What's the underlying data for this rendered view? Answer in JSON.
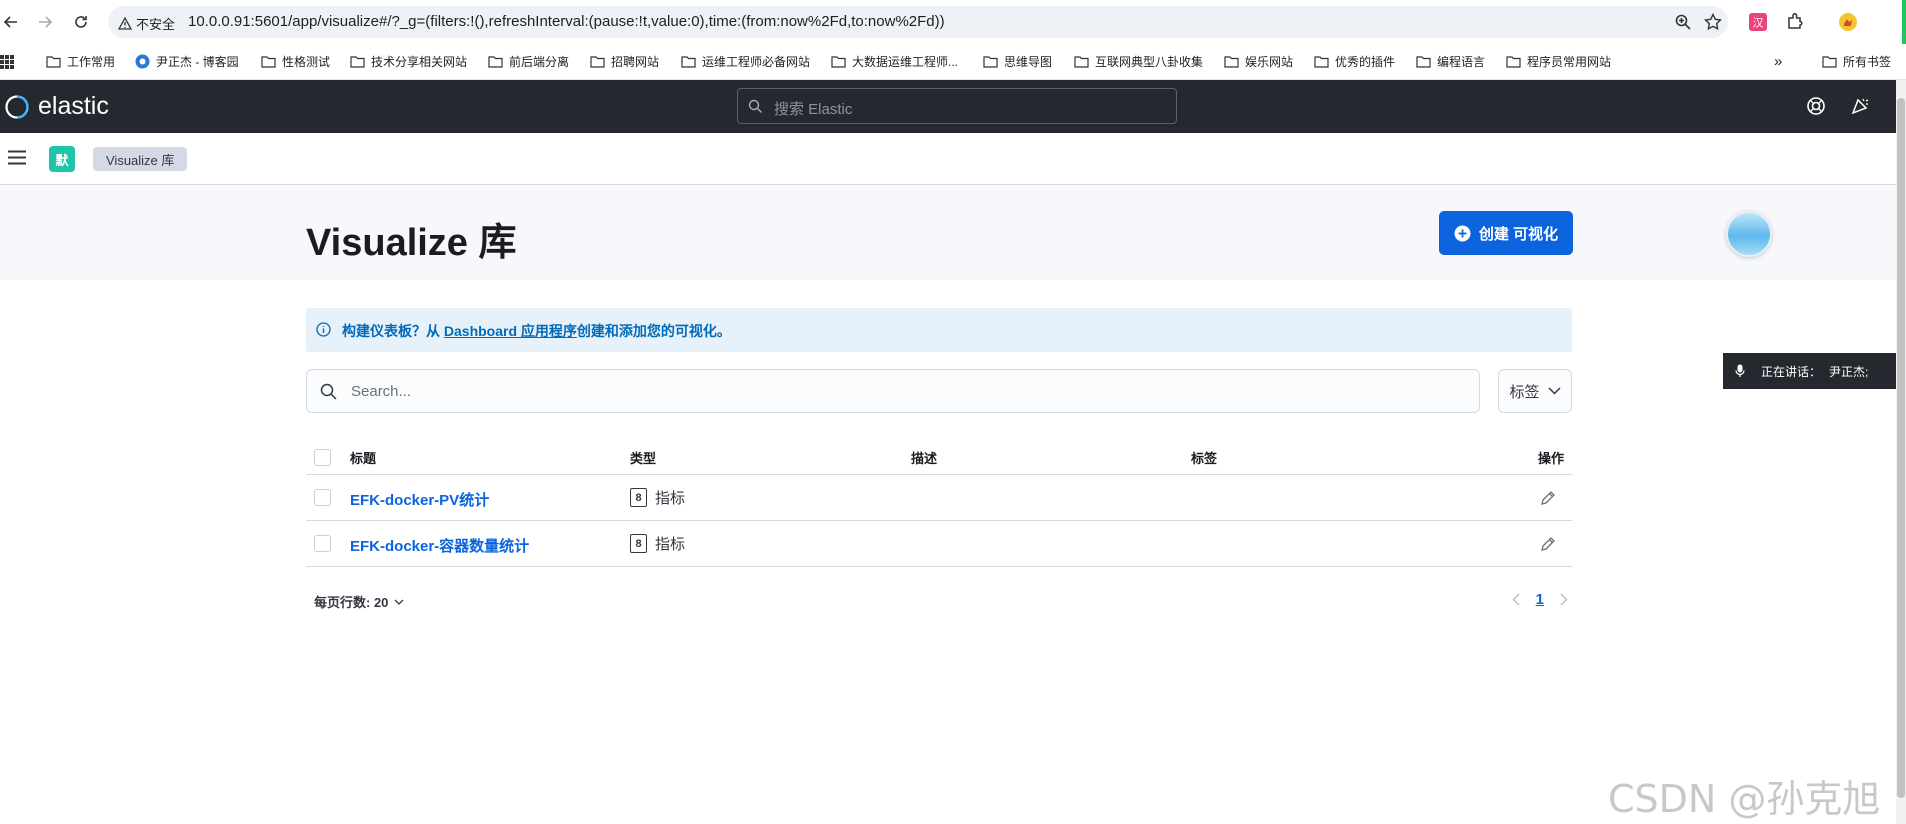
{
  "browser": {
    "security_label": "不安全",
    "url": "10.0.0.91:5601/app/visualize#/?_g=(filters:!(),refreshInterval:(pause:!t,value:0),time:(from:now%2Fd,to:now%2Fd))",
    "bookmarks": [
      "工作常用",
      "尹正杰 - 博客园",
      "性格测试",
      "技术分享相关网站",
      "前后端分离",
      "招聘网站",
      "运维工程师必备网站",
      "大数据运维工程师...",
      "思维导图",
      "互联网典型八卦收集",
      "娱乐网站",
      "优秀的插件",
      "编程语言",
      "程序员常用网站"
    ],
    "more_bookmarks": "»",
    "all_bookmarks": "所有书签"
  },
  "header": {
    "logo_text": "elastic",
    "search_placeholder": "搜索 Elastic"
  },
  "subheader": {
    "space_badge": "默",
    "breadcrumb": "Visualize 库"
  },
  "page": {
    "title": "Visualize 库",
    "create_button": "创建 可视化"
  },
  "callout": {
    "prefix": "构建仪表板？从 ",
    "link": "Dashboard 应用程序",
    "suffix": "创建和添加您的可视化。"
  },
  "search": {
    "placeholder": "Search..."
  },
  "tags_filter": "标签",
  "table": {
    "columns": [
      "标题",
      "类型",
      "描述",
      "标签",
      "操作"
    ],
    "rows": [
      {
        "title": "EFK-docker-PV统计",
        "type": "指标"
      },
      {
        "title": "EFK-docker-容器数量统计",
        "type": "指标"
      }
    ]
  },
  "pagination": {
    "rows_per_page": "每页行数: 20",
    "current_page": "1"
  },
  "speaking": {
    "label": "正在讲话：",
    "name": "尹正杰;"
  },
  "watermark": "CSDN @孙克旭"
}
